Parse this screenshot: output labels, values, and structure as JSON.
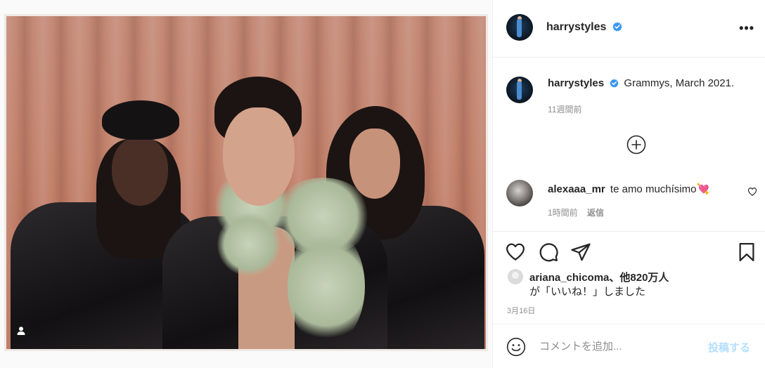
{
  "post": {
    "author": "harrystyles",
    "verified": true,
    "caption": "Grammys, March 2021.",
    "caption_time": "11週間前",
    "date": "3月16日"
  },
  "comments": [
    {
      "user": "alexaaa_mr",
      "text": "te amo muchísimo💘",
      "time": "1時間前",
      "reply_label": "返信"
    }
  ],
  "likes": {
    "line1": "ariana_chicoma、他820万人",
    "line2": "が「いいね！」しました"
  },
  "add_comment": {
    "placeholder": "コメントを追加...",
    "post_label": "投稿する"
  },
  "icons": {
    "more": "more-options-icon",
    "verified": "verified-badge-icon",
    "load_more": "plus-circle-icon",
    "like": "heart-icon",
    "comment": "comment-icon",
    "share": "paper-plane-icon",
    "save": "bookmark-icon",
    "emoji": "smiley-icon",
    "user_tag": "user-tag-icon"
  },
  "colors": {
    "verified_blue": "#3897f0",
    "post_button_disabled": "#b2dffc",
    "secondary_text": "#8e8e8e"
  }
}
